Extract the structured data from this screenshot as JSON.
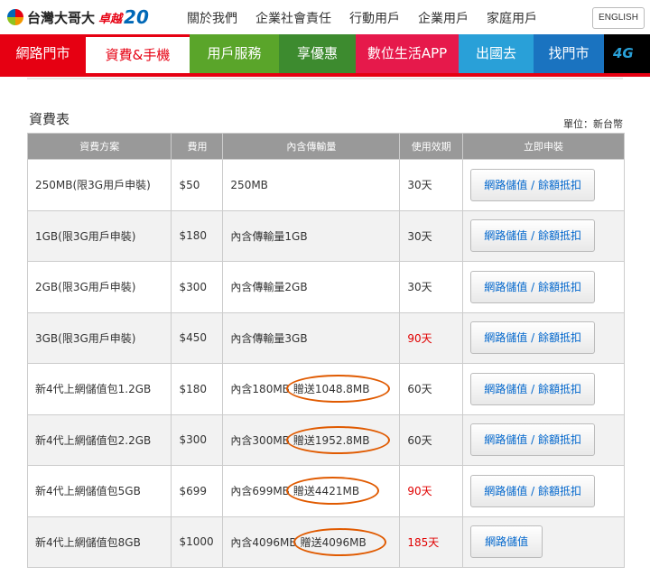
{
  "header": {
    "logo_text": "台灣大哥大",
    "logo_sub": "卓越",
    "logo_number": "20",
    "links": [
      "關於我們",
      "企業社會責任",
      "行動用戶",
      "企業用戶",
      "家庭用戶"
    ],
    "english": "ENGLISH"
  },
  "nav": {
    "items": [
      {
        "label": "網路門市",
        "color": "#e60012",
        "width": 95
      },
      {
        "label": "資費&手機",
        "color": "#e60012",
        "width": 115
      },
      {
        "label": "用戶服務",
        "color": "#5aa52a",
        "width": 99
      },
      {
        "label": "享優惠",
        "color": "#3d8b2f",
        "width": 85
      },
      {
        "label": "數位生活APP",
        "color": "#e6194b",
        "width": 114
      },
      {
        "label": "出國去",
        "color": "#29a0d8",
        "width": 83
      },
      {
        "label": "找門市",
        "color": "#1a73c0",
        "width": 78
      },
      {
        "label": "4G",
        "color": "#000000",
        "width": 51
      }
    ]
  },
  "page": {
    "title": "資費表",
    "unit": "單位：新台幣"
  },
  "table": {
    "headers": [
      "資費方案",
      "費用",
      "內含傳輸量",
      "使用效期",
      "立即申裝"
    ],
    "rows": [
      {
        "plan": "250MB(限3G用戶申裝)",
        "price": "$50",
        "data": "250MB",
        "bonus": "",
        "validity": "30天",
        "red": false,
        "button": "網路儲值 / 餘額抵扣"
      },
      {
        "plan": "1GB(限3G用戶申裝)",
        "price": "$180",
        "data": "內含傳輸量1GB",
        "bonus": "",
        "validity": "30天",
        "red": false,
        "button": "網路儲值 / 餘額抵扣"
      },
      {
        "plan": "2GB(限3G用戶申裝)",
        "price": "$300",
        "data": "內含傳輸量2GB",
        "bonus": "",
        "validity": "30天",
        "red": false,
        "button": "網路儲值 / 餘額抵扣"
      },
      {
        "plan": "3GB(限3G用戶申裝)",
        "price": "$450",
        "data": "內含傳輸量3GB",
        "bonus": "",
        "validity": "90天",
        "red": true,
        "button": "網路儲值 / 餘額抵扣"
      },
      {
        "plan": "新4代上網儲值包1.2GB",
        "price": "$180",
        "data": "內含180MB",
        "bonus": "贈送1048.8MB",
        "validity": "60天",
        "red": false,
        "button": "網路儲值 / 餘額抵扣"
      },
      {
        "plan": "新4代上網儲值包2.2GB",
        "price": "$300",
        "data": "內含300MB",
        "bonus": "贈送1952.8MB",
        "validity": "60天",
        "red": false,
        "button": "網路儲值 / 餘額抵扣"
      },
      {
        "plan": "新4代上網儲值包5GB",
        "price": "$699",
        "data": "內含699MB",
        "bonus": "贈送4421MB",
        "validity": "90天",
        "red": true,
        "button": "網路儲值 / 餘額抵扣"
      },
      {
        "plan": "新4代上網儲值包8GB",
        "price": "$1000",
        "data": "內含4096MB",
        "bonus": "贈送4096MB",
        "validity": "185天",
        "red": true,
        "button": "網路儲值"
      }
    ]
  }
}
